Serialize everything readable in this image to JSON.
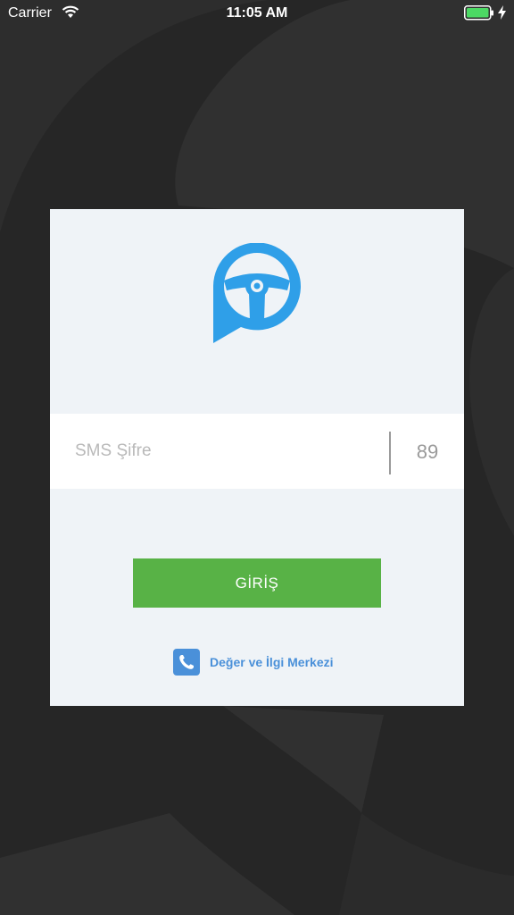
{
  "status_bar": {
    "carrier": "Carrier",
    "time": "11:05 AM",
    "battery_level": 1.0
  },
  "login": {
    "sms_placeholder": "SMS Şifre",
    "sms_value": "",
    "countdown": "89",
    "login_label": "GİRİŞ",
    "support_label": "Değer ve İlgi Merkezi"
  },
  "colors": {
    "background": "#262626",
    "card": "#eff3f7",
    "accent_blue": "#2f9fe8",
    "button_green": "#58b246",
    "link_blue": "#4a90d9"
  },
  "icons": {
    "logo": "steering-wheel-chat-bubble-icon",
    "support": "phone-icon"
  }
}
